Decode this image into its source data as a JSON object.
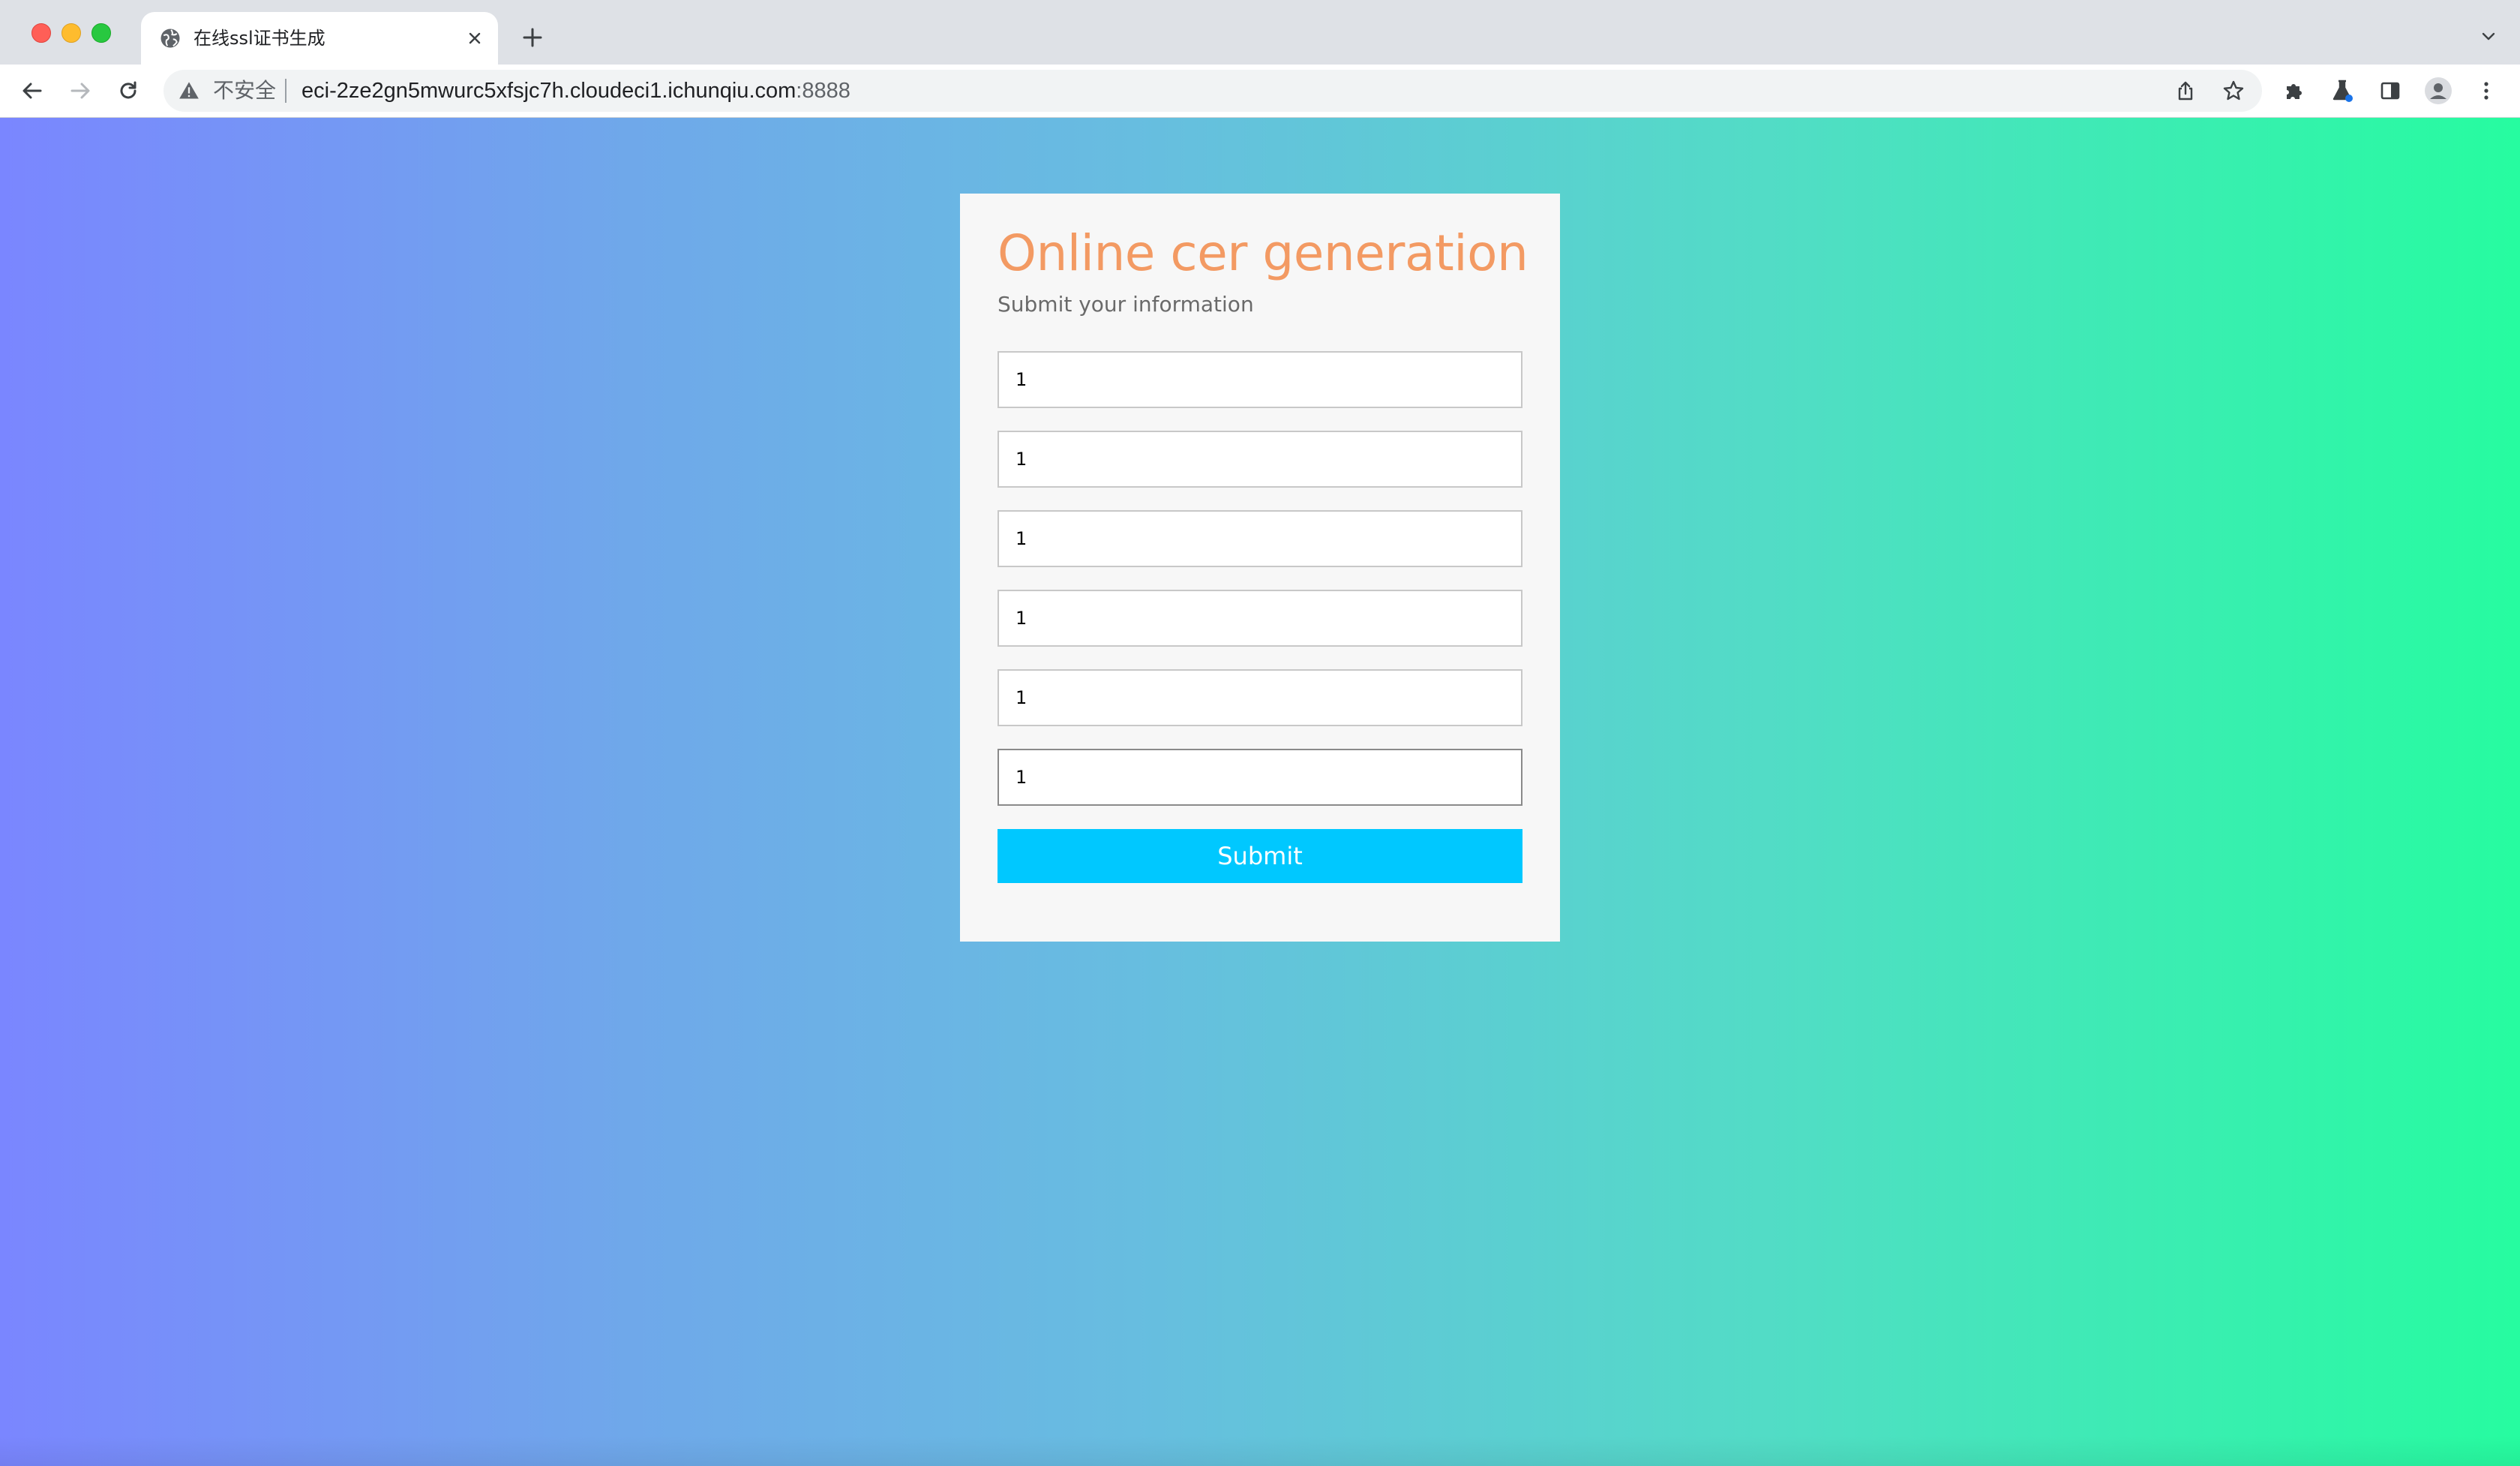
{
  "browser": {
    "tab": {
      "title": "在线ssl证书生成",
      "favicon": "globe-icon",
      "close_icon": "close-icon"
    },
    "new_tab_icon": "plus-icon",
    "tab_search_icon": "chevron-down-icon",
    "nav": {
      "back_icon": "back-arrow-icon",
      "forward_icon": "forward-arrow-icon",
      "reload_icon": "reload-icon"
    },
    "address_bar": {
      "security_icon": "warning-triangle-icon",
      "security_label": "不安全",
      "host": "eci-2ze2gn5mwurc5xfsjc7h.cloudeci1.ichunqiu.com",
      "port": ":8888",
      "share_icon": "share-icon",
      "bookmark_icon": "star-icon"
    },
    "toolbar_icons": [
      "puzzle-icon",
      "labs-flask-icon",
      "side-panel-icon",
      "profile-avatar-icon",
      "kebab-menu-icon"
    ]
  },
  "page": {
    "title": "Online cer generation",
    "subtitle": "Submit your information",
    "fields": [
      {
        "value": "1"
      },
      {
        "value": "1"
      },
      {
        "value": "1"
      },
      {
        "value": "1"
      },
      {
        "value": "1"
      },
      {
        "value": "1"
      }
    ],
    "submit_label": "Submit",
    "colors": {
      "title": "#f39a63",
      "submit": "#00c8ff",
      "gradient_start": "#7a86ff",
      "gradient_end": "#26fca0"
    }
  }
}
